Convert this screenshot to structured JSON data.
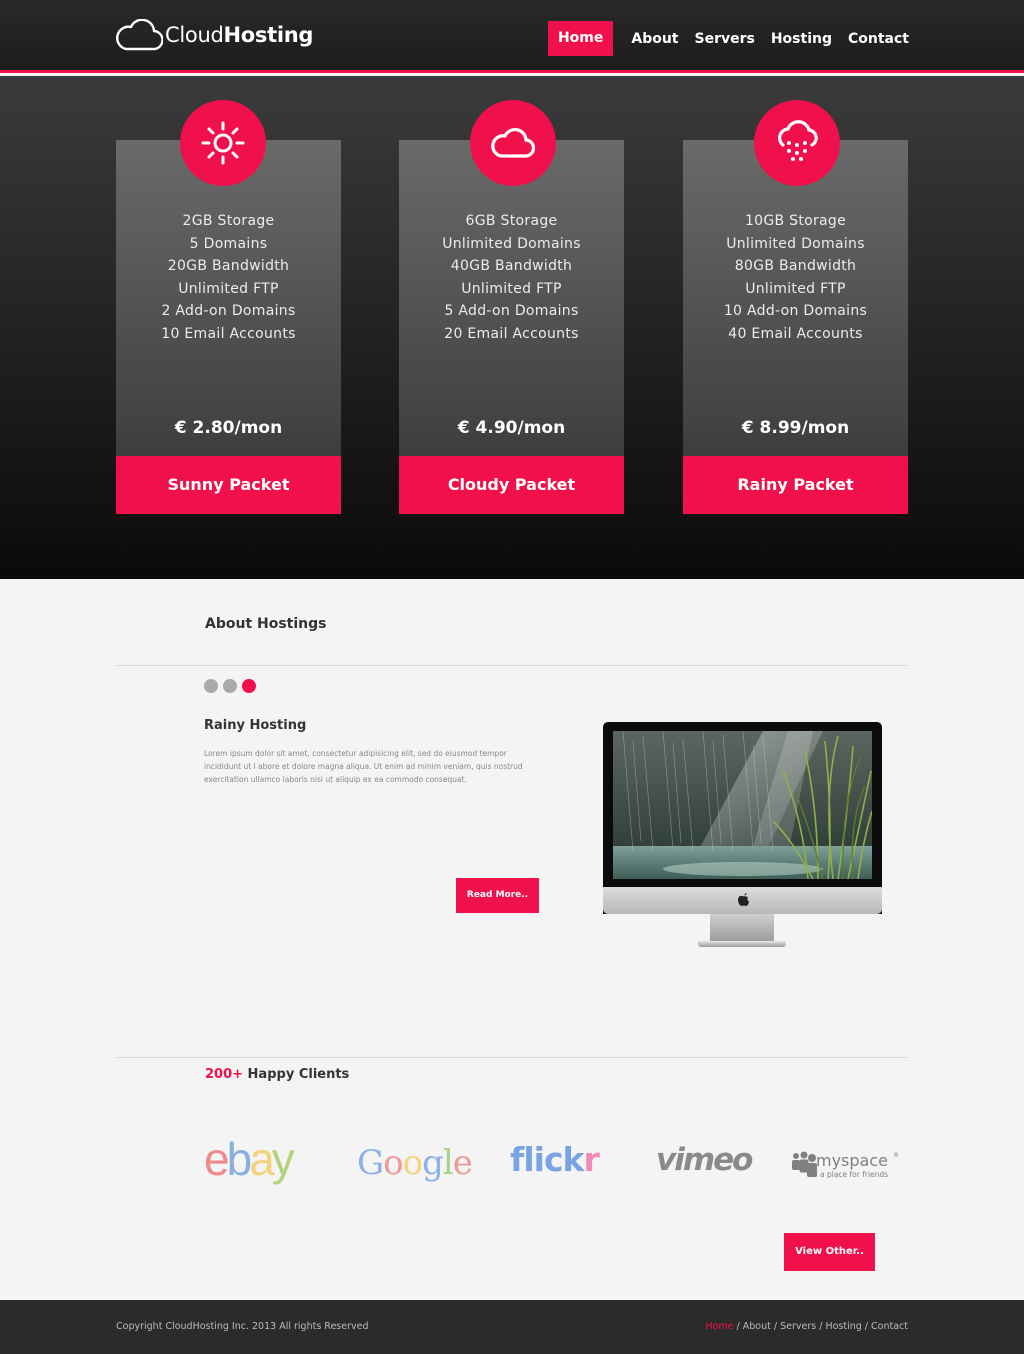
{
  "brand": {
    "name_light": "Cloud",
    "name_bold": "Hosting"
  },
  "nav": {
    "home": "Home",
    "about": "About",
    "servers": "Servers",
    "hosting": "Hosting",
    "contact": "Contact"
  },
  "plans": [
    {
      "icon": "sun-icon",
      "features": [
        "2GB  Storage",
        "5  Domains",
        "20GB  Bandwidth",
        "Unlimited  FTP",
        "2 Add-on  Domains",
        "10  Email  Accounts"
      ],
      "price": "€ 2.80/mon",
      "name": "Sunny Packet"
    },
    {
      "icon": "cloud-icon",
      "features": [
        "6GB  Storage",
        "Unlimited  Domains",
        "40GB  Bandwidth",
        "Unlimited  FTP",
        "5 Add-on  Domains",
        "20  Email  Accounts"
      ],
      "price": "€ 4.90/mon",
      "name": "Cloudy Packet"
    },
    {
      "icon": "rain-cloud-icon",
      "features": [
        "10GB  Storage",
        "Unlimited  Domains",
        "80GB  Bandwidth",
        "Unlimited  FTP",
        "10 Add-on  Domains",
        "40  Email  Accounts"
      ],
      "price": "€ 8.99/mon",
      "name": "Rainy Packet"
    }
  ],
  "about": {
    "title": "About Hostings",
    "slide_title": "Rainy Hosting",
    "slide_text": "Lorem ipsum dolor sit amet, consectetur adipisicing elit, sed do eiusmod tempor incididunt ut l abore et dolore magna aliqua. Ut enim ad minim veniam, quis nostrud exercitation ullamco laboris nisi ut aliquip ex ea commodo consequat.",
    "read_more": "Read More..",
    "active_dot": 3
  },
  "clients": {
    "count": "200+",
    "label": " Happy Clients",
    "logos": {
      "ebay": "ebay",
      "google": "Google",
      "flickr": "flickr",
      "vimeo": "vimeo",
      "myspace": "myspace",
      "myspace_tag": "a place for friends"
    },
    "view_other": "View Other.."
  },
  "footer": {
    "copyright": "Copyright CloudHosting Inc. 2013  All rights Reserved",
    "links": [
      "Home",
      "About",
      "Servers",
      "Hosting",
      "Contact"
    ]
  },
  "colors": {
    "accent": "#f0104b",
    "dark": "#1c1c1c",
    "light_bg": "#f4f4f4"
  }
}
